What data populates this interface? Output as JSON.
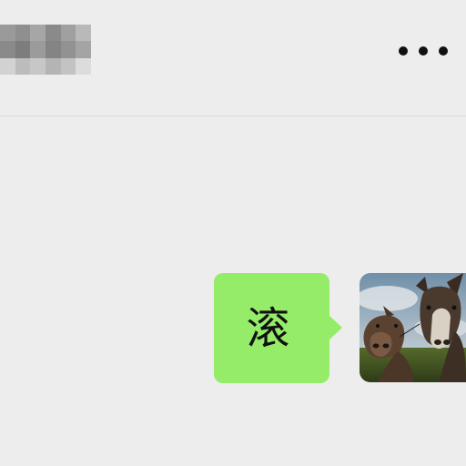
{
  "header": {
    "more_icon": "more-dots-icon"
  },
  "chat": {
    "messages": [
      {
        "sender": "self",
        "text": "滚"
      }
    ]
  },
  "avatar": {
    "icon": "donkey-photo"
  },
  "colors": {
    "background": "#ededed",
    "bubble": "#95ec69",
    "text": "#111111"
  }
}
